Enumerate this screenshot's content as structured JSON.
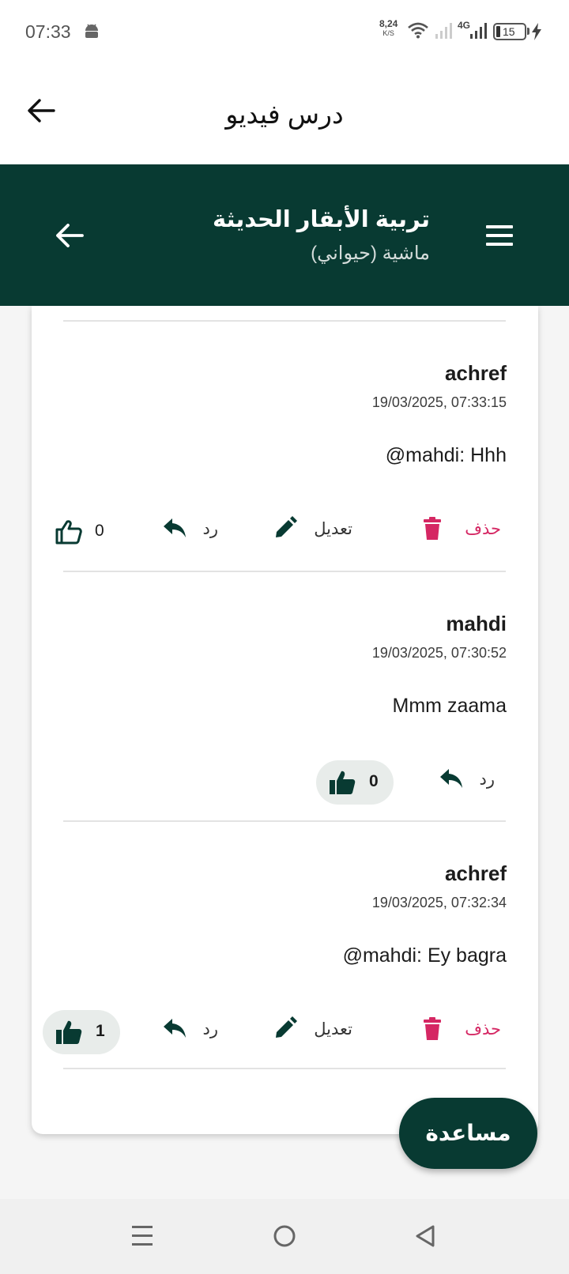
{
  "status_bar": {
    "time": "07:33",
    "net_speed": "8,24",
    "net_speed_unit": "K/S",
    "network_type": "4G",
    "battery": "15",
    "icons": [
      "android-icon",
      "wifi-icon",
      "signal-icon",
      "signal-icon",
      "battery-icon",
      "charging-icon"
    ]
  },
  "top_bar": {
    "title": "درس فيديو",
    "back_icon": "arrow-left-icon"
  },
  "course_header": {
    "title": "تربية الأبقار الحديثة",
    "subtitle": "ماشية (حيواني)",
    "menu_icon": "hamburger-icon",
    "back_icon": "arrow-left-icon",
    "background": "#083a32"
  },
  "actions": {
    "delete": "حذف",
    "edit": "تعديل",
    "reply": "رد"
  },
  "colors": {
    "accent": "#083a32",
    "delete": "#d52763"
  },
  "comments": [
    {
      "author": "achref",
      "date": "19/03/2025, 07:33:15",
      "text": "@mahdi: Hhh",
      "likes": "0",
      "liked": false,
      "can_edit": true
    },
    {
      "author": "mahdi",
      "date": "19/03/2025, 07:30:52",
      "text": "Mmm zaama",
      "likes": "0",
      "liked": true,
      "can_edit": false
    },
    {
      "author": "achref",
      "date": "19/03/2025, 07:32:34",
      "text": "@mahdi: Ey bagra",
      "likes": "1",
      "liked": true,
      "can_edit": true
    }
  ],
  "help_button": {
    "label": "مساعدة"
  },
  "nav_bar": {
    "icons": [
      "recents-icon",
      "home-icon",
      "back-icon"
    ]
  }
}
